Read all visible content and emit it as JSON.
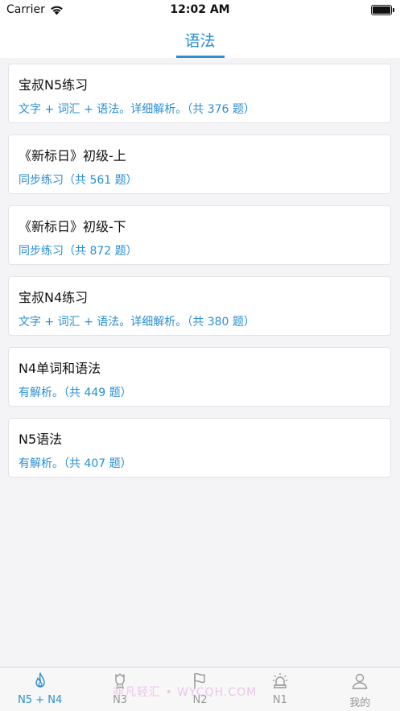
{
  "status": {
    "carrier": "Carrier",
    "time": "12:02 AM"
  },
  "nav": {
    "title": "语法"
  },
  "items": [
    {
      "title": "宝叔N5练习",
      "subtitle": "文字 + 词汇 + 语法。详细解析。（共 376 题）"
    },
    {
      "title": "《新标日》初级-上",
      "subtitle": "同步练习（共 561 题）"
    },
    {
      "title": "《新标日》初级-下",
      "subtitle": "同步练习（共 872 题）"
    },
    {
      "title": "宝叔N4练习",
      "subtitle": "文字 + 词汇 + 语法。详细解析。（共 380 题）"
    },
    {
      "title": "N4单词和语法",
      "subtitle": "有解析。（共 449 题）"
    },
    {
      "title": "N5语法",
      "subtitle": "有解析。（共 407 题）"
    }
  ],
  "tabs": [
    {
      "label": "N5 + N4",
      "icon": "flame-icon"
    },
    {
      "label": "N3",
      "icon": "badge-icon"
    },
    {
      "label": "N2",
      "icon": "flag-icon"
    },
    {
      "label": "N1",
      "icon": "lamp-icon"
    },
    {
      "label": "我的",
      "icon": "person-icon"
    }
  ],
  "watermark": "非凡轻汇 • WYCQH.COM",
  "colors": {
    "accent": "#2a8fd5",
    "inactive": "#999999"
  }
}
